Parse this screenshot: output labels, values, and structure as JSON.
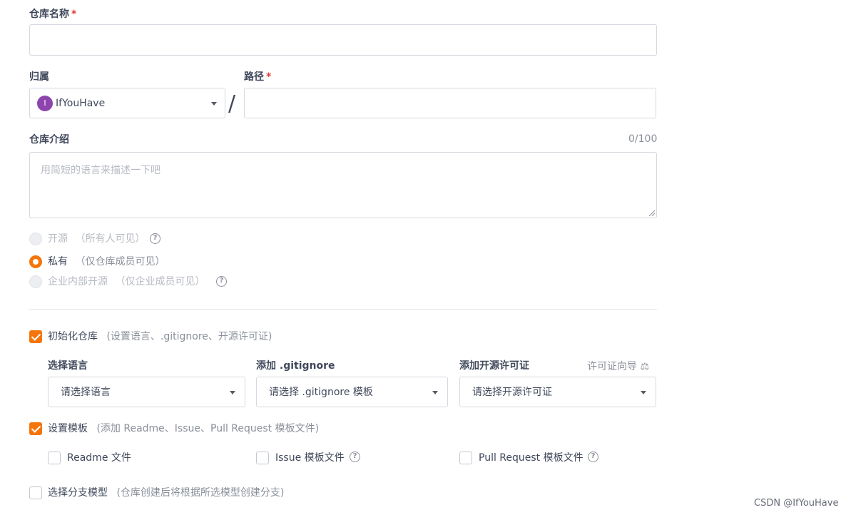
{
  "repo_name": {
    "label": "仓库名称",
    "required_mark": "*",
    "value": ""
  },
  "owner": {
    "label": "归属",
    "avatar_letter": "I",
    "value": "IfYouHave"
  },
  "separator": "/",
  "path": {
    "label": "路径",
    "required_mark": "*",
    "value": ""
  },
  "description": {
    "label": "仓库介绍",
    "counter": "0/100",
    "placeholder": "用简短的语言来描述一下吧"
  },
  "visibility": {
    "options": [
      {
        "label": "开源",
        "hint": "（所有人可见）",
        "state": "disabled",
        "has_help": true
      },
      {
        "label": "私有",
        "hint": "（仅仓库成员可见）",
        "state": "checked",
        "has_help": false
      },
      {
        "label": "企业内部开源",
        "hint": "（仅企业成员可见）",
        "state": "disabled",
        "has_help": true
      }
    ]
  },
  "init_repo": {
    "label": "初始化仓库",
    "hint": "(设置语言、.gitignore、开源许可证)",
    "checked": true
  },
  "language": {
    "label": "选择语言",
    "value": "请选择语言"
  },
  "gitignore": {
    "label": "添加 .gitignore",
    "value": "请选择 .gitignore 模板"
  },
  "license": {
    "label": "添加开源许可证",
    "value": "请选择开源许可证",
    "guide_link": "许可证向导",
    "guide_icon": "scale-icon"
  },
  "templates": {
    "label": "设置模板",
    "hint": "(添加 Readme、Issue、Pull Request 模板文件)",
    "checked": true,
    "items": [
      {
        "label": "Readme 文件",
        "checked": false,
        "has_help": false
      },
      {
        "label": "Issue 模板文件",
        "checked": false,
        "has_help": true
      },
      {
        "label": "Pull Request 模板文件",
        "checked": false,
        "has_help": true
      }
    ]
  },
  "branch_model": {
    "label": "选择分支模型",
    "hint": "(仓库创建后将根据所选模型创建分支)",
    "checked": false
  },
  "watermark": "CSDN @IfYouHave",
  "colors": {
    "accent": "#f5750a",
    "avatar": "#8e44ad",
    "text": "#40485b",
    "muted": "#8a8f99",
    "disabled": "#b6bac2",
    "border": "#d5d8de"
  }
}
